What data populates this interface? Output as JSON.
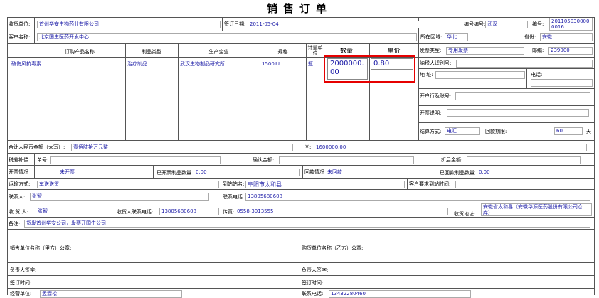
{
  "title": "销售订单",
  "header": {
    "seller_label": "收货单位:",
    "seller_value": "首州华安生物药业有限公司",
    "sign_date_label": "签订日期:",
    "sign_date_value": "2011-05-04",
    "order_no_label": "编号编号:",
    "order_no_value": "武汉",
    "number_label": "编号:",
    "number_value": "2011050300000016",
    "customer_label": "客户名称:",
    "customer_value": "北京国生医药开发中心",
    "region_label": "所在区域:",
    "region_value": "华北",
    "province_label": "省份:",
    "province_value": "安徽"
  },
  "columns": {
    "product": "订购产品名称",
    "category": "制品类型",
    "maker": "生产企业",
    "spec": "规格",
    "unit": "计量单位",
    "qty": "数量",
    "price": "单价"
  },
  "row": {
    "product": "破伤风抗毒素",
    "category": "治疗制品",
    "maker": "武汉生物制品研究所",
    "spec": "1500IU",
    "unit": "瓶",
    "qty": "2000000.00",
    "price": "0.80"
  },
  "invoice": {
    "type_label": "发票类型:",
    "type_value": "专用发票",
    "postcode_label": "邮编:",
    "postcode_value": "239000",
    "taxid_label": "纳税人识别号:",
    "address_label": "地 址:",
    "phone_label": "电话:",
    "bank_label": "开户行及账号:",
    "note_label": "开票说明:",
    "settle_label": "结算方式:",
    "settle_value": "电汇",
    "payterm_label": "回款期限:",
    "payterm_value": "60",
    "payterm_unit": "天"
  },
  "total": {
    "label": "合计人民币金额（大写）:",
    "caps_value": "壹佰陆拾万元整",
    "yen_label": "￥:",
    "yen_value": "1600000.00"
  },
  "tax": {
    "label": "税差补偿",
    "doc_label": "单号:",
    "confirm_label": "确认金额:",
    "discount_label": "折后金额:"
  },
  "billing": {
    "label": "开票情况",
    "status": "未开票",
    "billed_qty_label": "已开票制品数量",
    "billed_qty_value": "0.00",
    "payment_label": "回款情况",
    "payment_status": "未回款",
    "paid_qty_label": "已回款制品数量",
    "paid_qty_value": "0.00"
  },
  "transport": {
    "method_label": "运输方式:",
    "method_value": "车送送货",
    "arrival_label": "到站站名:",
    "arrival_value": "阜阳市太和县",
    "requirement_label": "客户要求到站时间:"
  },
  "contact": {
    "label": "联系人:",
    "value": "张智",
    "phone_label": "联系电话",
    "phone_value": "13805680608"
  },
  "receiver": {
    "label": "收 货 人:",
    "value": "张智",
    "phone_label": "收货人联系电话:",
    "phone_value": "13805680608",
    "fax_label": "传真:",
    "fax_value": "0558-3013555",
    "addr_label": "收货地址:",
    "addr_value": "安徽省太和县（安徽华源医药股份有限公司仓库）"
  },
  "remark": {
    "label": "备注:",
    "value": "货发首州华安公司，发票开国生公司"
  },
  "stamps": {
    "seller_label": "销售单位名称（甲方）公章:",
    "buyer_label": "购货单位名称（乙方）公章:",
    "signer_a": "负责人签字:",
    "signer_b": "负责人签字:",
    "date_a": "签订时间:",
    "date_b": "签订时间:",
    "bottom_a_label": "经营单位:",
    "bottom_a_value": "孟溜松",
    "bottom_b_label": "联系电话:",
    "bottom_b_value": "13432280460"
  }
}
